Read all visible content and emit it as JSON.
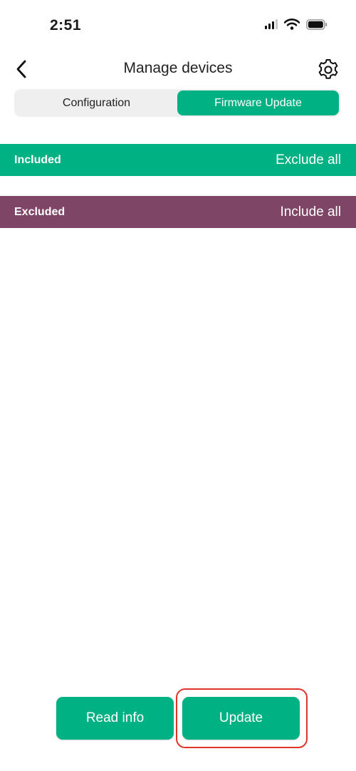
{
  "status_bar": {
    "time": "2:51",
    "icons": [
      "cellular-signal-icon",
      "wifi-icon",
      "battery-icon"
    ]
  },
  "header": {
    "title": "Manage devices",
    "back_icon": "chevron-left-icon",
    "settings_icon": "gear-icon"
  },
  "tabs": [
    {
      "label": "Configuration",
      "active": false
    },
    {
      "label": "Firmware Update",
      "active": true
    }
  ],
  "included_section": {
    "label": "Included",
    "action": "Exclude all",
    "color": "#00b183"
  },
  "excluded_section": {
    "label": "Excluded",
    "action": "Include all",
    "color": "#7e4566"
  },
  "buttons": {
    "read_info": "Read info",
    "update": "Update"
  },
  "colors": {
    "accent": "#00b183",
    "excluded": "#7e4566",
    "highlight": "#e0342b"
  }
}
